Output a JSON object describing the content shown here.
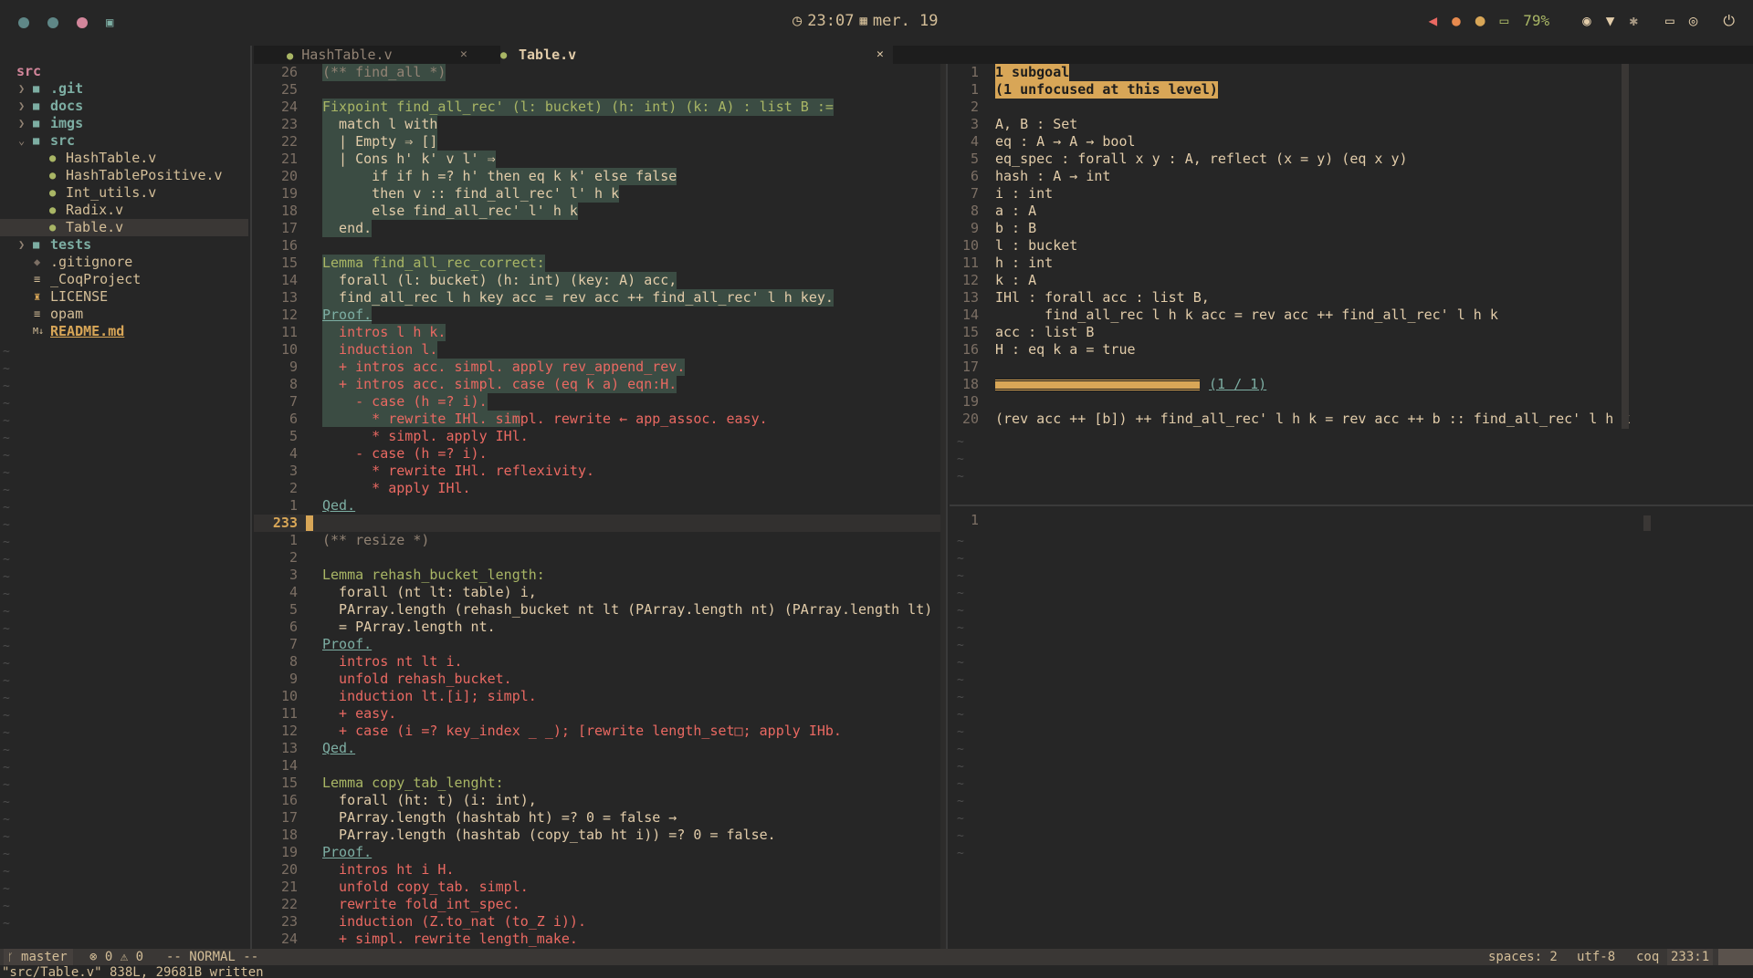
{
  "topbar": {
    "time": "23:07",
    "date": "mer. 19",
    "battery": "79%",
    "colors": {
      "dot1": "#5f8787",
      "dot2": "#5f8787",
      "dot3": "#d3869b",
      "accent": "#d8a657"
    }
  },
  "sidebar": {
    "root": "src",
    "items": [
      {
        "label": ".git",
        "kind": "folder",
        "depth": 0,
        "open": false
      },
      {
        "label": "docs",
        "kind": "folder",
        "depth": 0,
        "open": false
      },
      {
        "label": "imgs",
        "kind": "folder",
        "depth": 0,
        "open": false
      },
      {
        "label": "src",
        "kind": "folder",
        "depth": 0,
        "open": true
      },
      {
        "label": "HashTable.v",
        "kind": "coq",
        "depth": 1
      },
      {
        "label": "HashTablePositive.v",
        "kind": "coq",
        "depth": 1
      },
      {
        "label": "Int_utils.v",
        "kind": "coq",
        "depth": 1
      },
      {
        "label": "Radix.v",
        "kind": "coq",
        "depth": 1
      },
      {
        "label": "Table.v",
        "kind": "coq",
        "depth": 1,
        "selected": true
      },
      {
        "label": "tests",
        "kind": "folder",
        "depth": 0,
        "open": false
      },
      {
        "label": ".gitignore",
        "kind": "git",
        "depth": 0
      },
      {
        "label": "_CoqProject",
        "kind": "file",
        "depth": 0
      },
      {
        "label": "LICENSE",
        "kind": "license",
        "depth": 0
      },
      {
        "label": "opam",
        "kind": "file",
        "depth": 0
      },
      {
        "label": "README.md",
        "kind": "md",
        "depth": 0
      }
    ]
  },
  "tabs": [
    {
      "label": "HashTable.v",
      "close": "✕",
      "active": false
    },
    {
      "label": "Table.v",
      "close": "✕",
      "active": true
    }
  ],
  "editor_top": {
    "lines": [
      {
        "n": "26",
        "t": "(** find_all *)"
      },
      {
        "n": "25",
        "t": ""
      },
      {
        "n": "24",
        "t": "Fixpoint find_all_rec' (l: bucket) (h: int) (k: A) : list B :="
      },
      {
        "n": "23",
        "t": "  match l with"
      },
      {
        "n": "22",
        "t": "  | Empty ⇒ []"
      },
      {
        "n": "21",
        "t": "  | Cons h' k' v l' ⇒"
      },
      {
        "n": "20",
        "t": "      if if h =? h' then eq k k' else false"
      },
      {
        "n": "19",
        "t": "      then v :: find_all_rec' l' h k"
      },
      {
        "n": "18",
        "t": "      else find_all_rec' l' h k"
      },
      {
        "n": "17",
        "t": "  end."
      },
      {
        "n": "16",
        "t": ""
      },
      {
        "n": "15",
        "t": "Lemma find_all_rec_correct:"
      },
      {
        "n": "14",
        "t": "  forall (l: bucket) (h: int) (key: A) acc,"
      },
      {
        "n": "13",
        "t": "  find_all_rec l h key acc = rev acc ++ find_all_rec' l h key."
      },
      {
        "n": "12",
        "t": "Proof."
      },
      {
        "n": "11",
        "t": "  intros l h k."
      },
      {
        "n": "10",
        "t": "  induction l."
      },
      {
        "n": "9",
        "t": "  + intros acc. simpl. apply rev_append_rev."
      },
      {
        "n": "8",
        "t": "  + intros acc. simpl. case (eq k a) eqn:H."
      },
      {
        "n": "7",
        "t": "    - case (h =? i)."
      },
      {
        "n": "6",
        "t": "      * rewrite IHl. simpl. rewrite ← app_assoc. easy."
      },
      {
        "n": "5",
        "t": "      * simpl. apply IHl."
      },
      {
        "n": "4",
        "t": "    - case (h =? i)."
      },
      {
        "n": "3",
        "t": "      * rewrite IHl. reflexivity."
      },
      {
        "n": "2",
        "t": "      * apply IHl."
      },
      {
        "n": "1",
        "t": "Qed."
      },
      {
        "n": "233",
        "t": ""
      },
      {
        "n": "1",
        "t": "(** resize *)"
      },
      {
        "n": "2",
        "t": ""
      },
      {
        "n": "3",
        "t": "Lemma rehash_bucket_length:"
      },
      {
        "n": "4",
        "t": "  forall (nt lt: table) i,"
      },
      {
        "n": "5",
        "t": "  PArray.length (rehash_bucket nt lt (PArray.length nt) (PArray.length lt) i"
      },
      {
        "n": "6",
        "t": "  = PArray.length nt."
      },
      {
        "n": "7",
        "t": "Proof."
      },
      {
        "n": "8",
        "t": "  intros nt lt i."
      },
      {
        "n": "9",
        "t": "  unfold rehash_bucket."
      },
      {
        "n": "10",
        "t": "  induction lt.[i]; simpl."
      },
      {
        "n": "11",
        "t": "  + easy."
      },
      {
        "n": "12",
        "t": "  + case (i =? key_index _ _); [rewrite length_set□; apply IHb."
      },
      {
        "n": "13",
        "t": "Qed."
      },
      {
        "n": "14",
        "t": ""
      },
      {
        "n": "15",
        "t": "Lemma copy_tab_lenght:"
      },
      {
        "n": "16",
        "t": "  forall (ht: t) (i: int),"
      },
      {
        "n": "17",
        "t": "  PArray.length (hashtab ht) =? 0 = false →"
      },
      {
        "n": "18",
        "t": "  PArray.length (hashtab (copy_tab ht i)) =? 0 = false."
      },
      {
        "n": "19",
        "t": "Proof."
      },
      {
        "n": "20",
        "t": "  intros ht i H."
      },
      {
        "n": "21",
        "t": "  unfold copy_tab. simpl."
      },
      {
        "n": "22",
        "t": "  rewrite fold_int_spec."
      },
      {
        "n": "23",
        "t": "  induction (Z.to_nat (to_Z i))."
      },
      {
        "n": "24",
        "t": "  + simpl. rewrite length_make."
      }
    ]
  },
  "goals": {
    "lines": [
      {
        "n": "1",
        "t": "1 subgoal"
      },
      {
        "n": "1",
        "t": "(1 unfocused at this level)"
      },
      {
        "n": "2",
        "t": ""
      },
      {
        "n": "3",
        "t": "A, B : Set"
      },
      {
        "n": "4",
        "t": "eq : A → A → bool"
      },
      {
        "n": "5",
        "t": "eq_spec : forall x y : A, reflect (x = y) (eq x y)"
      },
      {
        "n": "6",
        "t": "hash : A → int"
      },
      {
        "n": "7",
        "t": "i : int"
      },
      {
        "n": "8",
        "t": "a : A"
      },
      {
        "n": "9",
        "t": "b : B"
      },
      {
        "n": "10",
        "t": "l : bucket"
      },
      {
        "n": "11",
        "t": "h : int"
      },
      {
        "n": "12",
        "t": "k : A"
      },
      {
        "n": "13",
        "t": "IHl : forall acc : list B,"
      },
      {
        "n": "14",
        "t": "      find_all_rec l h k acc = rev acc ++ find_all_rec' l h k"
      },
      {
        "n": "15",
        "t": "acc : list B"
      },
      {
        "n": "16",
        "t": "H : eq k a = true"
      },
      {
        "n": "17",
        "t": ""
      },
      {
        "n": "18",
        "t": "(1 / 1)"
      },
      {
        "n": "19",
        "t": ""
      },
      {
        "n": "20",
        "t": "(rev acc ++ [b]) ++ find_all_rec' l h k = rev acc ++ b :: find_all_rec' l h k"
      }
    ]
  },
  "infoview": {
    "lines": [
      {
        "n": "1",
        "t": ""
      }
    ]
  },
  "statusbar": {
    "branch": "master",
    "errors": "0",
    "warnings": "0",
    "mode": "-- NORMAL --",
    "spaces": "spaces: 2",
    "encoding": "utf-8",
    "filetype": "coq",
    "position": "233:1"
  },
  "cmdline": "\"src/Table.v\" 838L, 29681B written"
}
